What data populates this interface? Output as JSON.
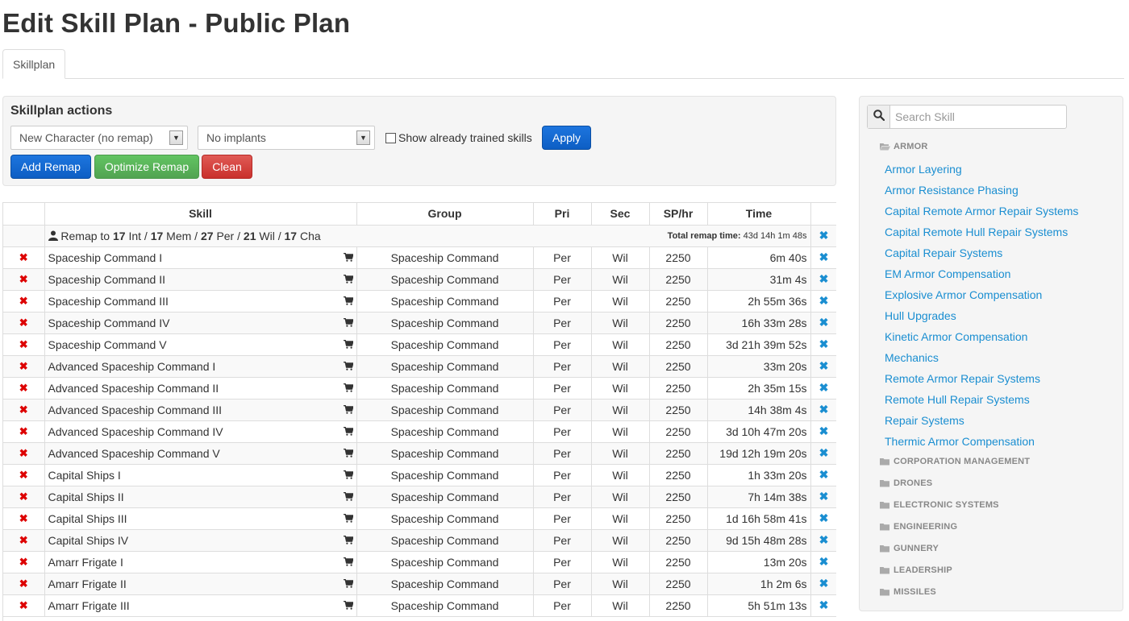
{
  "page": {
    "title": "Edit Skill Plan - Public Plan"
  },
  "tabs": [
    {
      "label": "Skillplan"
    }
  ],
  "actions": {
    "title": "Skillplan actions",
    "character_select": "New Character (no remap)",
    "implant_select": "No implants",
    "show_trained_label": "Show already trained skills",
    "apply_label": "Apply",
    "add_remap_label": "Add Remap",
    "optimize_remap_label": "Optimize Remap",
    "clean_label": "Clean"
  },
  "table": {
    "headers": {
      "skill": "Skill",
      "group": "Group",
      "pri": "Pri",
      "sec": "Sec",
      "sphr": "SP/hr",
      "time": "Time"
    },
    "remap": {
      "prefix": "Remap to",
      "int_value": "17",
      "int_label": "Int",
      "mem_value": "17",
      "mem_label": "Mem",
      "per_value": "27",
      "per_label": "Per",
      "wil_value": "21",
      "wil_label": "Wil",
      "cha_value": "17",
      "cha_label": "Cha",
      "total_label": "Total remap time:",
      "total_value": "43d 14h 1m 48s"
    },
    "rows": [
      {
        "skill": "Spaceship Command I",
        "group": "Spaceship Command",
        "pri": "Per",
        "sec": "Wil",
        "sphr": "2250",
        "time": "6m 40s"
      },
      {
        "skill": "Spaceship Command II",
        "group": "Spaceship Command",
        "pri": "Per",
        "sec": "Wil",
        "sphr": "2250",
        "time": "31m 4s"
      },
      {
        "skill": "Spaceship Command III",
        "group": "Spaceship Command",
        "pri": "Per",
        "sec": "Wil",
        "sphr": "2250",
        "time": "2h 55m 36s"
      },
      {
        "skill": "Spaceship Command IV",
        "group": "Spaceship Command",
        "pri": "Per",
        "sec": "Wil",
        "sphr": "2250",
        "time": "16h 33m 28s"
      },
      {
        "skill": "Spaceship Command V",
        "group": "Spaceship Command",
        "pri": "Per",
        "sec": "Wil",
        "sphr": "2250",
        "time": "3d 21h 39m 52s"
      },
      {
        "skill": "Advanced Spaceship Command I",
        "group": "Spaceship Command",
        "pri": "Per",
        "sec": "Wil",
        "sphr": "2250",
        "time": "33m 20s"
      },
      {
        "skill": "Advanced Spaceship Command II",
        "group": "Spaceship Command",
        "pri": "Per",
        "sec": "Wil",
        "sphr": "2250",
        "time": "2h 35m 15s"
      },
      {
        "skill": "Advanced Spaceship Command III",
        "group": "Spaceship Command",
        "pri": "Per",
        "sec": "Wil",
        "sphr": "2250",
        "time": "14h 38m 4s"
      },
      {
        "skill": "Advanced Spaceship Command IV",
        "group": "Spaceship Command",
        "pri": "Per",
        "sec": "Wil",
        "sphr": "2250",
        "time": "3d 10h 47m 20s"
      },
      {
        "skill": "Advanced Spaceship Command V",
        "group": "Spaceship Command",
        "pri": "Per",
        "sec": "Wil",
        "sphr": "2250",
        "time": "19d 12h 19m 20s"
      },
      {
        "skill": "Capital Ships I",
        "group": "Spaceship Command",
        "pri": "Per",
        "sec": "Wil",
        "sphr": "2250",
        "time": "1h 33m 20s"
      },
      {
        "skill": "Capital Ships II",
        "group": "Spaceship Command",
        "pri": "Per",
        "sec": "Wil",
        "sphr": "2250",
        "time": "7h 14m 38s"
      },
      {
        "skill": "Capital Ships III",
        "group": "Spaceship Command",
        "pri": "Per",
        "sec": "Wil",
        "sphr": "2250",
        "time": "1d 16h 58m 41s"
      },
      {
        "skill": "Capital Ships IV",
        "group": "Spaceship Command",
        "pri": "Per",
        "sec": "Wil",
        "sphr": "2250",
        "time": "9d 15h 48m 28s"
      },
      {
        "skill": "Amarr Frigate I",
        "group": "Spaceship Command",
        "pri": "Per",
        "sec": "Wil",
        "sphr": "2250",
        "time": "13m 20s"
      },
      {
        "skill": "Amarr Frigate II",
        "group": "Spaceship Command",
        "pri": "Per",
        "sec": "Wil",
        "sphr": "2250",
        "time": "1h 2m 6s"
      },
      {
        "skill": "Amarr Frigate III",
        "group": "Spaceship Command",
        "pri": "Per",
        "sec": "Wil",
        "sphr": "2250",
        "time": "5h 51m 13s"
      }
    ]
  },
  "sidebar": {
    "search_placeholder": "Search Skill",
    "open_group": "ARMOR",
    "armor_skills": [
      "Armor Layering",
      "Armor Resistance Phasing",
      "Capital Remote Armor Repair Systems",
      "Capital Remote Hull Repair Systems",
      "Capital Repair Systems",
      "EM Armor Compensation",
      "Explosive Armor Compensation",
      "Hull Upgrades",
      "Kinetic Armor Compensation",
      "Mechanics",
      "Remote Armor Repair Systems",
      "Remote Hull Repair Systems",
      "Repair Systems",
      "Thermic Armor Compensation"
    ],
    "groups": [
      "CORPORATION MANAGEMENT",
      "DRONES",
      "ELECTRONIC SYSTEMS",
      "ENGINEERING",
      "GUNNERY",
      "LEADERSHIP",
      "MISSILES"
    ]
  },
  "colors": {
    "link": "#1a8ed1",
    "delete": "#dd0000",
    "primary": "#0d5ec4",
    "success": "#51a351",
    "danger": "#c9302c"
  }
}
